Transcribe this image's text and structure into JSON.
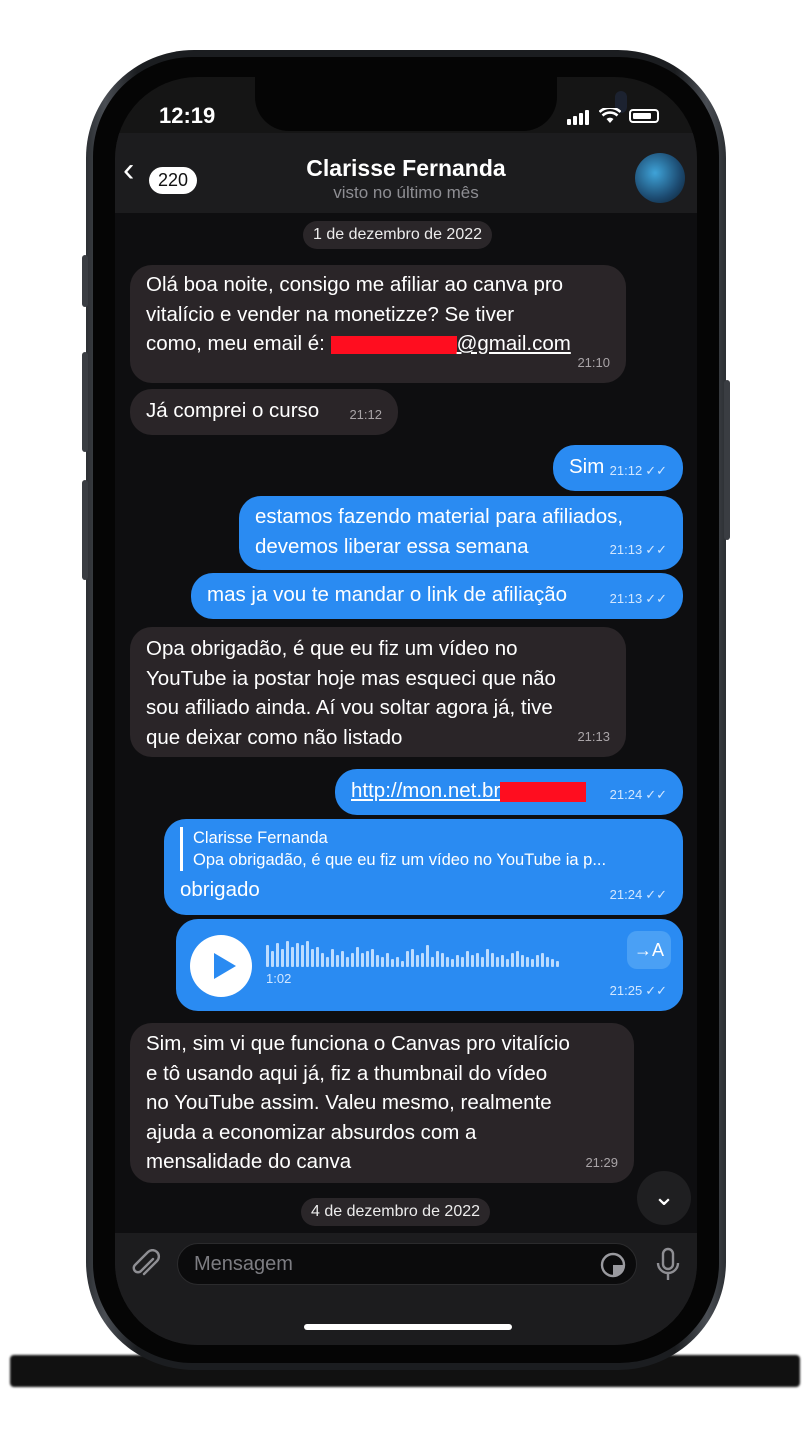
{
  "status": {
    "time": "12:19"
  },
  "header": {
    "back_count": "220",
    "name": "Clarisse Fernanda",
    "last_seen": "visto no último mês"
  },
  "dates": {
    "first": "1 de dezembro de 2022",
    "second": "4 de dezembro de 2022"
  },
  "messages": [
    {
      "lines": [
        "Olá boa noite, consigo me afiliar ao canva pro",
        "vitalício e vender na monetizze? Se tiver"
      ],
      "email_prefix": "como, meu email é: ",
      "email_suffix": "@gmail.com",
      "time": "21:10"
    },
    {
      "text": "Já comprei o curso",
      "time": "21:12"
    },
    {
      "text": "Sim",
      "time": "21:12"
    },
    {
      "lines": [
        "estamos fazendo material para afiliados,",
        "devemos liberar essa semana"
      ],
      "time": "21:13"
    },
    {
      "text": "mas ja vou te mandar o link de afiliação",
      "time": "21:13"
    },
    {
      "lines": [
        "Opa obrigadão, é que eu fiz um vídeo no",
        "YouTube ia postar hoje mas esqueci que não",
        "sou afiliado ainda. Aí vou soltar agora já, tive",
        "que deixar como não listado"
      ],
      "time": "21:13"
    },
    {
      "link": "http://mon.net.br",
      "time": "21:24"
    },
    {
      "reply_name": "Clarisse Fernanda",
      "reply_text": "Opa obrigadão, é que eu fiz um vídeo no YouTube ia p...",
      "text": "obrigado",
      "time": "21:24"
    },
    {
      "duration": "1:02",
      "transcribe": "→A",
      "time": "21:25"
    },
    {
      "lines": [
        "Sim, sim vi que funciona o Canvas pro vitalício",
        "e tô usando aqui já, fiz a thumbnail do vídeo",
        "no YouTube assim. Valeu mesmo, realmente",
        "ajuda a economizar absurdos com a",
        "mensalidade do canva"
      ],
      "time": "21:29"
    }
  ],
  "input": {
    "placeholder": "Mensagem"
  },
  "icons": {
    "back": "chevron-left-icon",
    "attach": "paperclip-icon",
    "sticker": "sticker-icon",
    "mic": "microphone-icon",
    "scroll": "chevron-down-icon"
  },
  "colors": {
    "outgoing": "#2a8bf2",
    "incoming": "#2a2528",
    "redaction": "#ff0d1f"
  }
}
